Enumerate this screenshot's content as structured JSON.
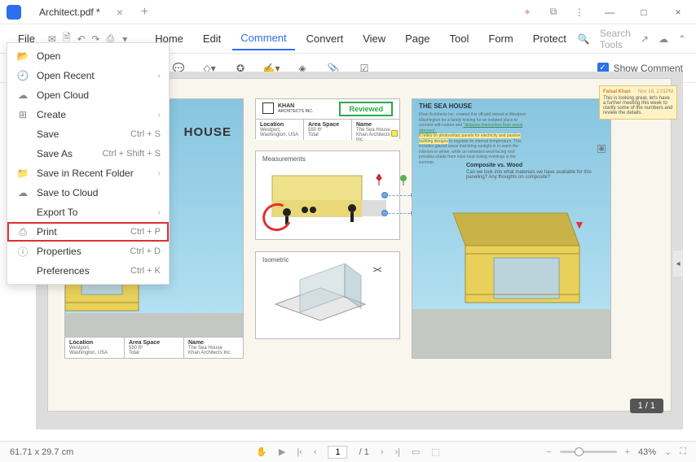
{
  "app": {
    "tab_title": "Architect.pdf *"
  },
  "menubar": {
    "file": "File",
    "items": [
      "Home",
      "Edit",
      "Comment",
      "Convert",
      "View",
      "Page",
      "Tool",
      "Form",
      "Protect"
    ],
    "active_index": 2,
    "search_placeholder": "Search Tools"
  },
  "file_menu": [
    {
      "icon": "folder-open",
      "label": "Open",
      "shortcut": "",
      "arrow": false
    },
    {
      "icon": "clock",
      "label": "Open Recent",
      "shortcut": "",
      "arrow": true
    },
    {
      "icon": "cloud",
      "label": "Open Cloud",
      "shortcut": "",
      "arrow": false
    },
    {
      "icon": "plus-box",
      "label": "Create",
      "shortcut": "",
      "arrow": true
    },
    {
      "icon": "",
      "label": "Save",
      "shortcut": "Ctrl + S",
      "arrow": false
    },
    {
      "icon": "",
      "label": "Save As",
      "shortcut": "Ctrl + Shift + S",
      "arrow": false
    },
    {
      "icon": "folder",
      "label": "Save in Recent Folder",
      "shortcut": "",
      "arrow": true
    },
    {
      "icon": "cloud-up",
      "label": "Save to Cloud",
      "shortcut": "",
      "arrow": false
    },
    {
      "icon": "",
      "label": "Export To",
      "shortcut": "",
      "arrow": true
    },
    {
      "icon": "printer",
      "label": "Print",
      "shortcut": "Ctrl + P",
      "arrow": false,
      "highlighted": true
    },
    {
      "icon": "info",
      "label": "Properties",
      "shortcut": "Ctrl + D",
      "arrow": false
    },
    {
      "icon": "",
      "label": "Preferences",
      "shortcut": "Ctrl + K",
      "arrow": false
    }
  ],
  "toolbar": {
    "show_comment": "Show Comment"
  },
  "doc": {
    "khan_brand": "KHAN",
    "khan_sub": "ARCHITECTS INC.",
    "reviewed": "Reviewed",
    "section_house_title": "HOUSE",
    "measurements_label": "Measurements",
    "isometric_label": "Isometric",
    "sea_house_title": "THE SEA HOUSE",
    "sea_house_desc": "Khan Architects Inc. created this off-grid retreat in Westport, Washington for a family looking for an isolated place to connect with nature and",
    "sea_house_quote": "\"distance themselves from social stresses\".",
    "sea_house_hl": "It relies on photovoltaic panels for electricity and passive building designs",
    "sea_house_rest": " to regulate its internal temperature. This includes glazed areas that bring sunlight in to warm the interiors in winter, while an extended west-facing roof provides shade from solar heat during evenings in the summer.",
    "cvw_title": "Composite vs. Wood",
    "cvw_desc": "Can we look into what materials we have available for this paneling? Any thoughts on composite?",
    "legend": {
      "location_h": "Location",
      "location_v1": "Westport,",
      "location_v2": "Washington, USA",
      "area_h": "Area Space",
      "area_v1": "550 ft²",
      "area_v2": "Total",
      "name_h": "Name",
      "name_v1": "The Sea House",
      "name_v2": "Khan Architects Inc."
    },
    "comment": {
      "author": "Faisal Khan",
      "date": "Nov 18, 2:01PM",
      "body": "This is looking great, let's have a further meeting this week to clarify some of the numbers and review the details."
    }
  },
  "status": {
    "dimensions": "61.71 x 29.7 cm",
    "page_current": "1",
    "page_total": "/ 1",
    "zoom": "43%",
    "page_indicator": "1 / 1"
  }
}
